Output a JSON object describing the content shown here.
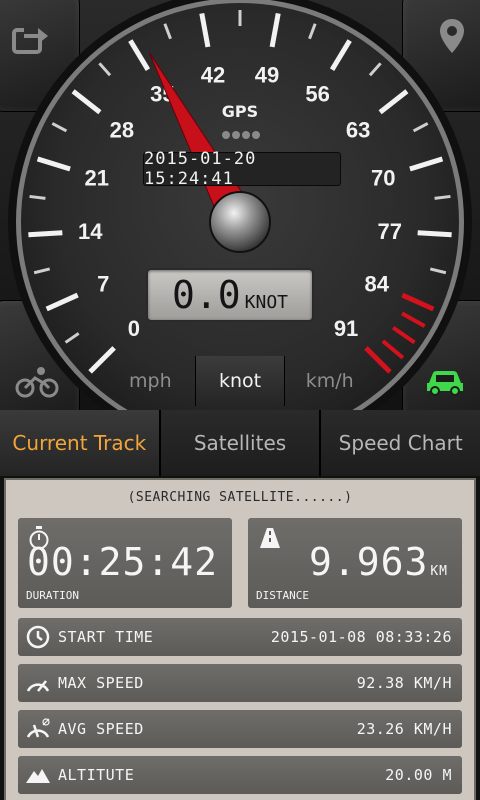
{
  "gauge": {
    "ticks": [
      "0",
      "7",
      "14",
      "21",
      "28",
      "35",
      "42",
      "49",
      "56",
      "63",
      "70",
      "77",
      "84",
      "91"
    ],
    "gps_label": "GPS",
    "datetime": "2015-01-20 15:24:41",
    "speed_value": "0.0",
    "speed_unit": "KNOT",
    "needle_value": 36,
    "colors": {
      "needle": "#c8101b",
      "redline": "#d4111c",
      "gps_dot": "#8a8a8a"
    }
  },
  "unit_tabs": [
    {
      "label": "mph",
      "selected": false
    },
    {
      "label": "knot",
      "selected": true
    },
    {
      "label": "km/h",
      "selected": false
    }
  ],
  "icons": {
    "top_left": "refresh-icon",
    "top_right": "location-pin-icon",
    "bottom_left": "cyclist-icon",
    "bottom_right": "car-icon",
    "car_color": "#3fd84a"
  },
  "tabs": [
    {
      "label": "Current Track",
      "selected": true
    },
    {
      "label": "Satellites",
      "selected": false
    },
    {
      "label": "Speed Chart",
      "selected": false
    }
  ],
  "status": "(SEARCHING SATELLITE......)",
  "duration": {
    "value": "00:25:42",
    "label": "DURATION"
  },
  "distance": {
    "value": "9.963",
    "unit": "KM",
    "label": "DISTANCE"
  },
  "rows": {
    "start_time": {
      "label": "START TIME",
      "value": "2015-01-08 08:33:26"
    },
    "max_speed": {
      "label": "MAX SPEED",
      "value": "92.38 KM/H"
    },
    "avg_speed": {
      "label": "AVG SPEED",
      "value": "23.26 KM/H"
    },
    "altitude": {
      "label": "ALTITUTE",
      "value": "20.00 M"
    }
  }
}
